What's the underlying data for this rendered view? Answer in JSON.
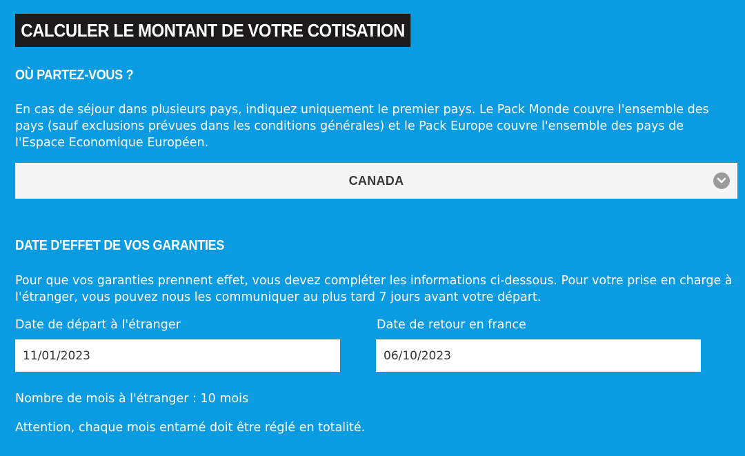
{
  "title": "CALCULER LE MONTANT DE VOTRE COTISATION",
  "destination": {
    "heading": "OÙ PARTEZ-VOUS ?",
    "description": "En cas de séjour dans plusieurs pays, indiquez uniquement le premier pays. Le Pack Monde couvre l'ensemble des pays (sauf exclusions prévues dans les conditions générales) et le Pack Europe couvre l'ensemble des pays de l'Espace Economique Européen.",
    "selected_country": "CANADA",
    "dropdown_icon": "chevron-down-circle-icon"
  },
  "dates": {
    "heading": "DATE D'EFFET DE VOS GARANTIES",
    "description": "Pour que vos garanties prennent effet, vous devez compléter les informations ci-dessous. Pour votre prise en charge à l'étranger, vous pouvez nous les communiquer au plus tard 7 jours avant votre départ.",
    "departure_label": "Date de départ à l'étranger",
    "departure_value": "11/01/2023",
    "return_label": "Date de retour en france",
    "return_value": "06/10/2023",
    "months_text": "Nombre de mois à l'étranger : 10 mois",
    "warning_text": "Attention, chaque mois entamé doit être réglé en totalité."
  },
  "colors": {
    "background": "#0a9be0",
    "title_background": "#1d1a1b",
    "select_background": "#f4f4f4",
    "chevron": "#9a9a9a"
  }
}
